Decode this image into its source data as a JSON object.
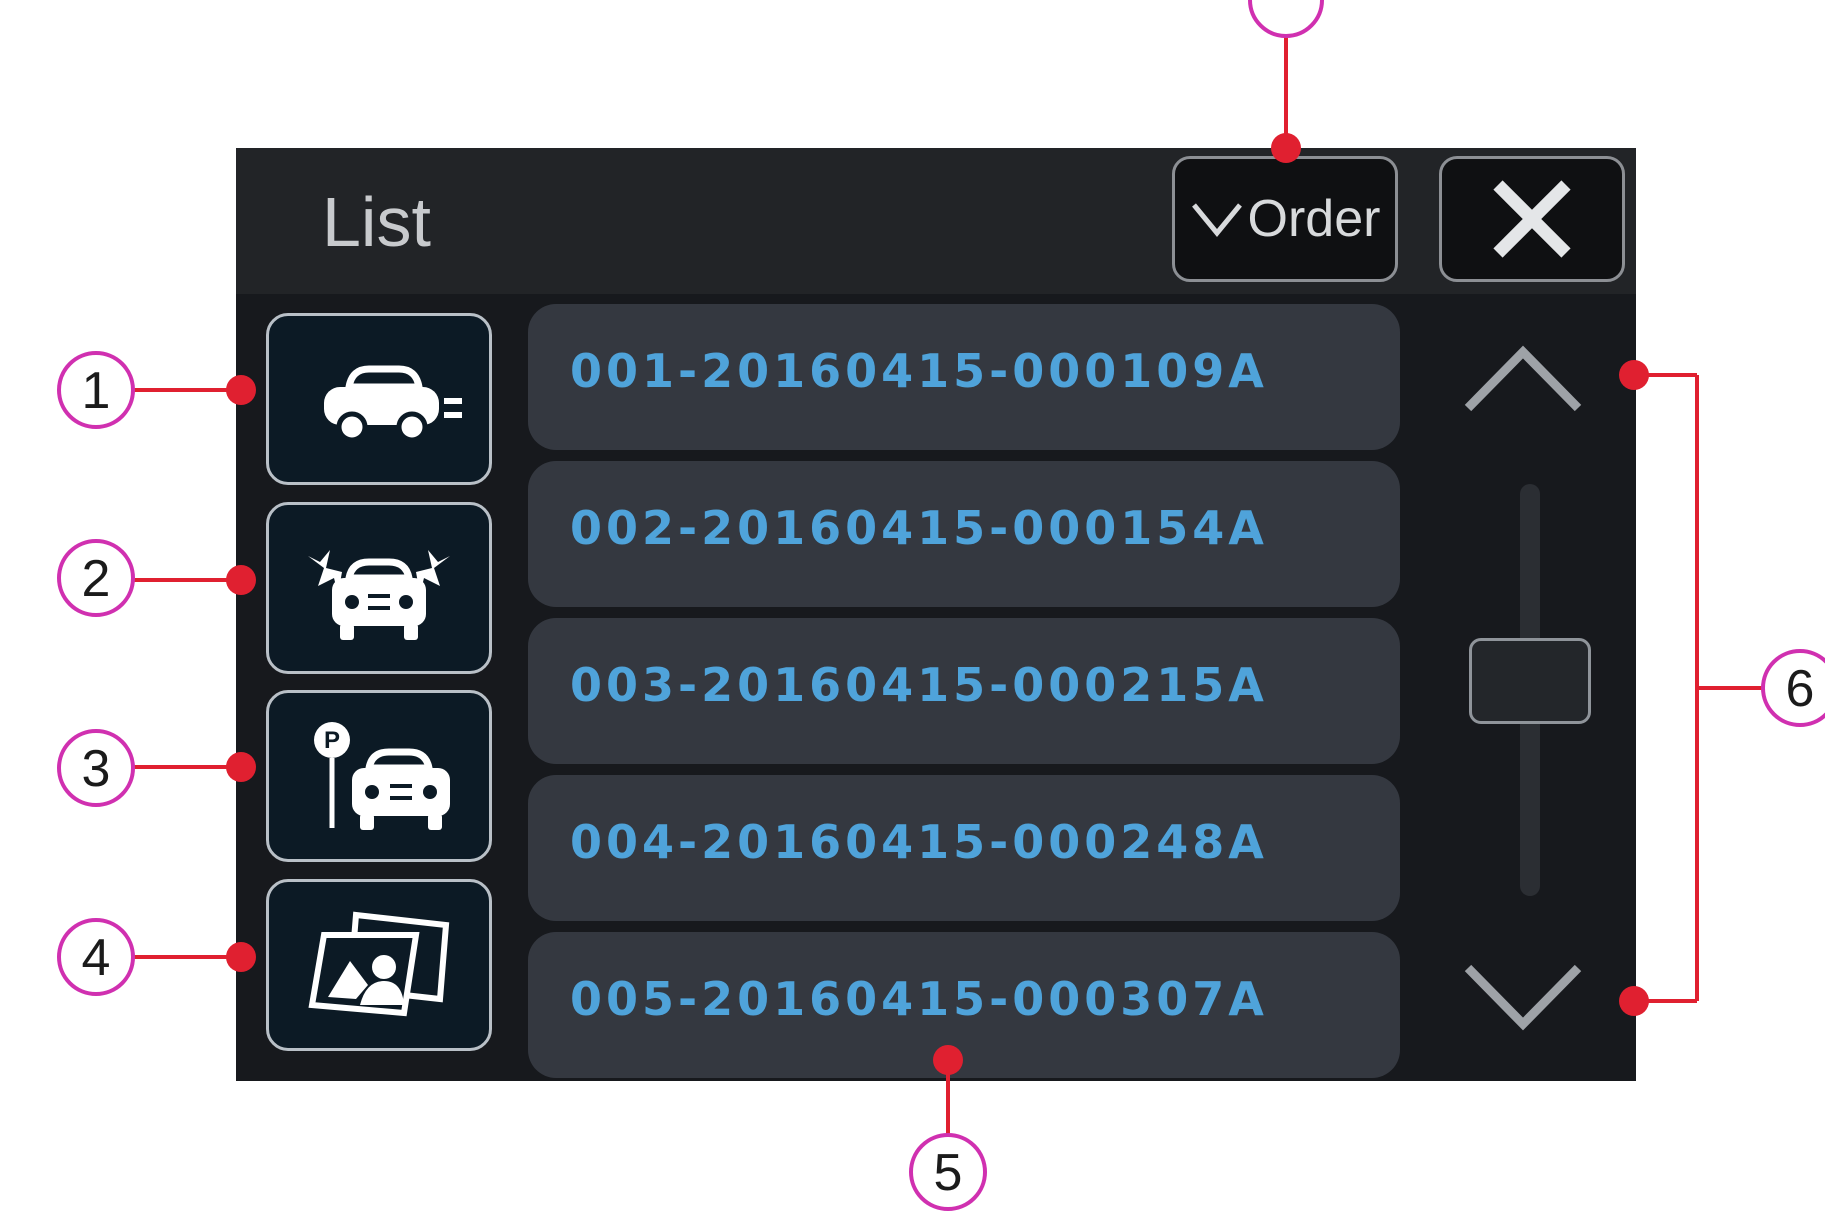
{
  "window": {
    "title": "List"
  },
  "header": {
    "order_label": "Order"
  },
  "categories": [
    {
      "icon": "car-driving-icon",
      "callout": "1"
    },
    {
      "icon": "car-impact-icon",
      "callout": "2"
    },
    {
      "icon": "car-parking-icon",
      "callout": "3"
    },
    {
      "icon": "photo-gallery-icon",
      "callout": "4"
    }
  ],
  "files": [
    {
      "name": "001-20160415-000109A"
    },
    {
      "name": "002-20160415-000154A"
    },
    {
      "name": "003-20160415-000215A"
    },
    {
      "name": "004-20160415-000248A"
    },
    {
      "name": "005-20160415-000307A"
    }
  ],
  "callouts": {
    "rows": "5",
    "scroll": "6"
  },
  "colors": {
    "panel_bg": "#17191d",
    "row_bg": "#343840",
    "row_text": "#4fa3da",
    "callout_line": "#e02030",
    "callout_circle": "#d030b0"
  }
}
